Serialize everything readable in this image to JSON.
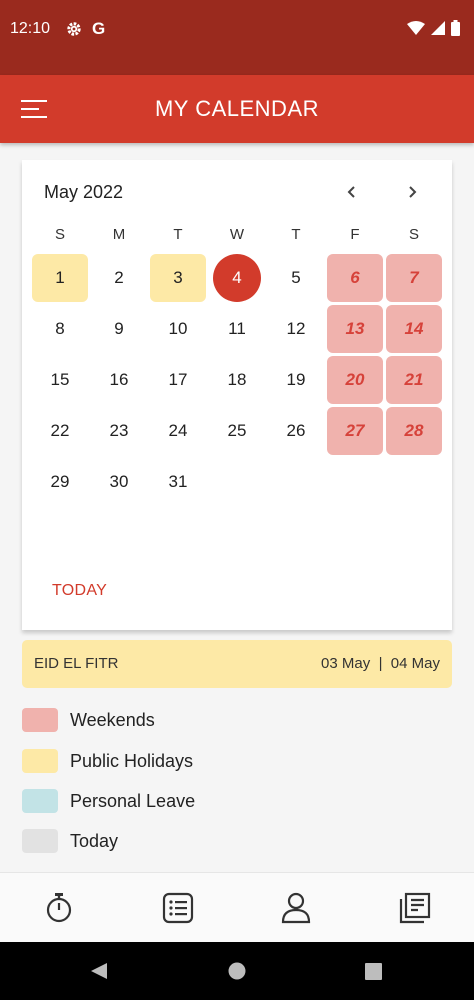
{
  "status": {
    "time": "12:10",
    "g_label": "G"
  },
  "app_bar": {
    "title": "MY CALENDAR"
  },
  "calendar": {
    "month_label": "May 2022",
    "weekdays": [
      "S",
      "M",
      "T",
      "W",
      "T",
      "F",
      "S"
    ],
    "weeks": [
      [
        "1",
        "2",
        "3",
        "4",
        "5",
        "6",
        "7"
      ],
      [
        "8",
        "9",
        "10",
        "11",
        "12",
        "13",
        "14"
      ],
      [
        "15",
        "16",
        "17",
        "18",
        "19",
        "20",
        "21"
      ],
      [
        "22",
        "23",
        "24",
        "25",
        "26",
        "27",
        "28"
      ],
      [
        "29",
        "30",
        "31",
        "",
        "",
        "",
        ""
      ]
    ],
    "today_label": "TODAY"
  },
  "holiday": {
    "name": "EID EL FITR",
    "dates": "03 May  |  04 May"
  },
  "legend": [
    {
      "label": "Weekends",
      "color": "#f0b2ad"
    },
    {
      "label": "Public Holidays",
      "color": "#fde9a6"
    },
    {
      "label": "Personal Leave",
      "color": "#c2e3e6"
    },
    {
      "label": "Today",
      "color": "#e2e2e2"
    }
  ],
  "colors": {
    "primary": "#d23b2b",
    "status_bar": "#9a2a1e",
    "weekend": "#f0b2ad",
    "holiday": "#fde9a6"
  },
  "bottom_nav": [
    {
      "icon": "stopwatch-icon"
    },
    {
      "icon": "list-icon"
    },
    {
      "icon": "person-icon"
    },
    {
      "icon": "documents-icon"
    }
  ]
}
